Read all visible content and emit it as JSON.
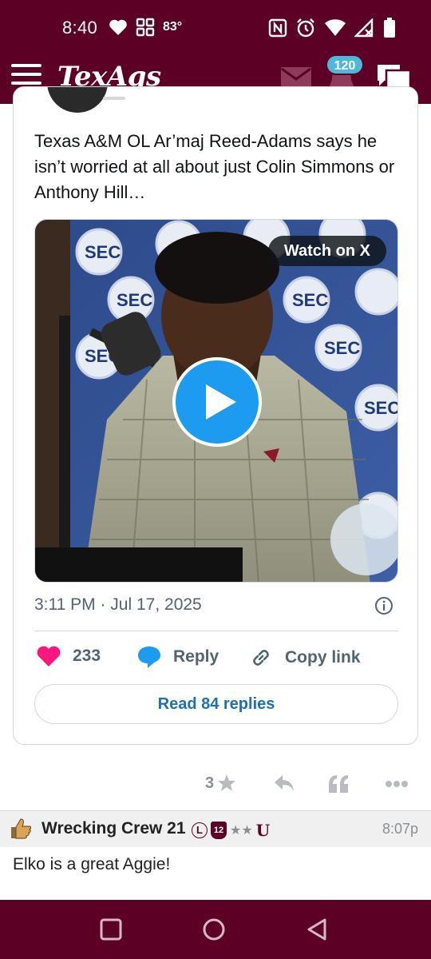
{
  "status_bar": {
    "time": "8:40",
    "temperature": "83°",
    "icons": [
      "heart-icon",
      "apps-grid-icon",
      "nfc-icon",
      "alarm-icon",
      "wifi-icon",
      "signal-icon",
      "battery-icon"
    ]
  },
  "header": {
    "logo": "TexAgs",
    "notification_count": "120",
    "icons": [
      "menu-icon",
      "mail-icon",
      "bell-icon",
      "chat-icon"
    ]
  },
  "tweet": {
    "text": "Texas A&M OL Ar’maj Reed-Adams says he isn’t worried at all about just Colin Simmons or Anthony Hill…",
    "watch_label": "Watch on X",
    "timestamp": "3:11 PM · Jul 17, 2025",
    "likes": "233",
    "reply_label": "Reply",
    "copy_label": "Copy link",
    "read_replies_label": "Read 84 replies"
  },
  "post_actions": {
    "rating": "3",
    "icons": [
      "star-icon",
      "reply-arrow-icon",
      "quote-icon",
      "more-icon"
    ]
  },
  "reply_post": {
    "username": "Wrecking Crew 21",
    "badges": [
      "L",
      "12",
      "★★",
      "U"
    ],
    "time": "8:07p",
    "body": "Elko is a great Aggie!"
  },
  "colors": {
    "maroon": "#5d0025",
    "x_blue": "#1d9bf0",
    "like_pink": "#f91880",
    "badge_blue": "#4fb7d8"
  }
}
